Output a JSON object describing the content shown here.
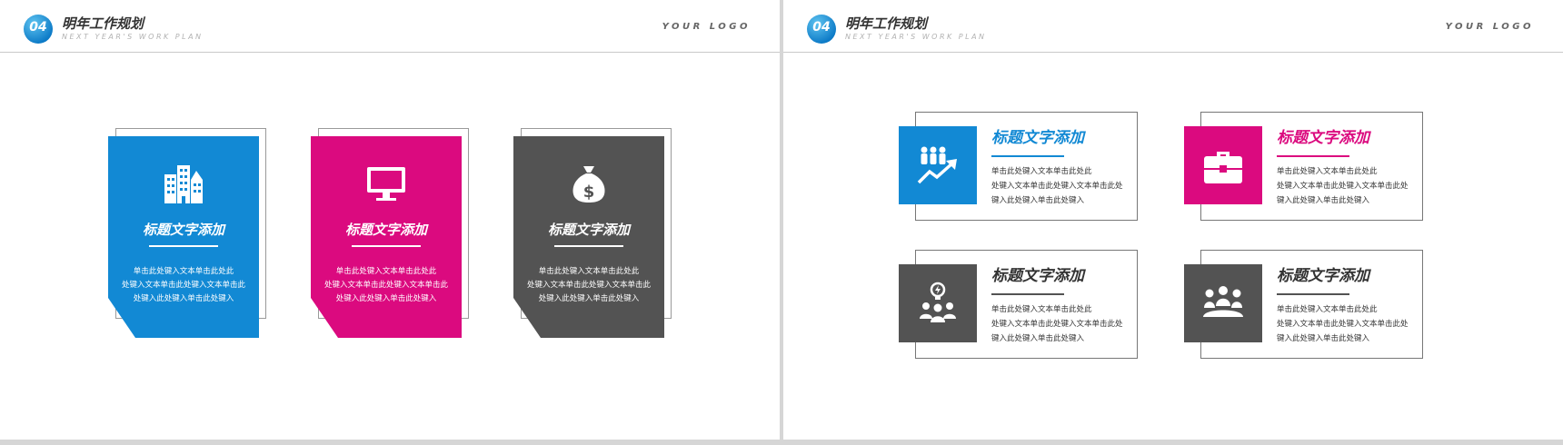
{
  "header": {
    "badge": "04",
    "title": "明年工作规划",
    "subtitle": "NEXT YEAR'S WORK PLAN",
    "logo": "YOUR LOGO"
  },
  "colors": {
    "blue": "#1289d4",
    "pink": "#db0a7f",
    "gray": "#535353"
  },
  "left_cards": [
    {
      "icon": "buildings-icon",
      "color": "#1289d4",
      "title": "标题文字添加",
      "lines": [
        "单击此处键入文本单击此处此",
        "处键入文本单击此处键入文本单击此",
        "处键入此处键入单击此处键入"
      ]
    },
    {
      "icon": "monitor-icon",
      "color": "#db0a7f",
      "title": "标题文字添加",
      "lines": [
        "单击此处键入文本单击此处此",
        "处键入文本单击此处键入文本单击此",
        "处键入此处键入单击此处键入"
      ]
    },
    {
      "icon": "money-bag-icon",
      "color": "#535353",
      "title": "标题文字添加",
      "lines": [
        "单击此处键入文本单击此处此",
        "处键入文本单击此处键入文本单击此",
        "处键入此处键入单击此处键入"
      ]
    }
  ],
  "right_boxes": [
    {
      "icon": "team-growth-icon",
      "color": "#1289d4",
      "title": "标题文字添加",
      "lines": [
        "单击此处键入文本单击此处此",
        "处键入文本单击此处键入文本单击此处",
        "键入此处键入单击此处键入"
      ]
    },
    {
      "icon": "briefcase-icon",
      "color": "#db0a7f",
      "title": "标题文字添加",
      "lines": [
        "单击此处键入文本单击此处此",
        "处键入文本单击此处键入文本单击此处",
        "键入此处键入单击此处键入"
      ]
    },
    {
      "icon": "idea-team-icon",
      "color": "#535353",
      "title": "标题文字添加",
      "lines": [
        "单击此处键入文本单击此处此",
        "处键入文本单击此处键入文本单击此处",
        "键入此处键入单击此处键入"
      ]
    },
    {
      "icon": "meeting-icon",
      "color": "#535353",
      "title": "标题文字添加",
      "lines": [
        "单击此处键入文本单击此处此",
        "处键入文本单击此处键入文本单击此处",
        "键入此处键入单击此处键入"
      ]
    }
  ]
}
